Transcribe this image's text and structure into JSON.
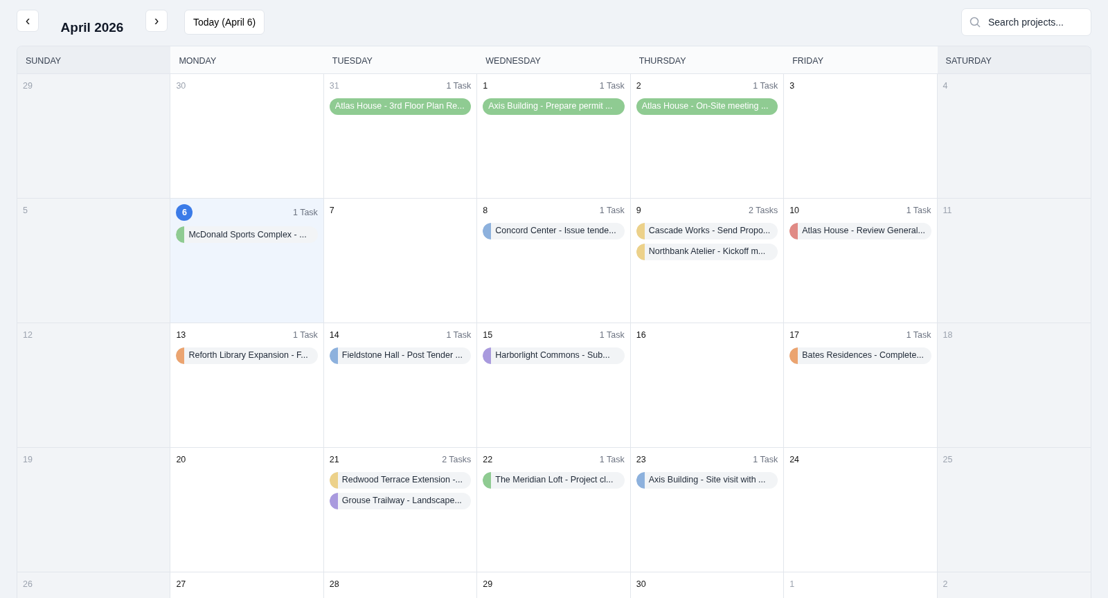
{
  "toolbar": {
    "prev": "‹",
    "month": "April 2026",
    "next": "›",
    "today_button": "Today (April 6)",
    "search": {
      "placeholder": "Search projects..."
    }
  },
  "weekdays": [
    {
      "label": "SUNDAY",
      "weekend": true
    },
    {
      "label": "MONDAY",
      "weekend": false
    },
    {
      "label": "TUESDAY",
      "weekend": false
    },
    {
      "label": "WEDNESDAY",
      "weekend": false
    },
    {
      "label": "THURSDAY",
      "weekend": false
    },
    {
      "label": "FRIDAY",
      "weekend": false
    },
    {
      "label": "SATURDAY",
      "weekend": true
    }
  ],
  "weeks": [
    {
      "days": [
        {
          "number": "29",
          "muted": true,
          "weekend": true,
          "today": false
        },
        {
          "number": "30",
          "muted": true,
          "weekend": false,
          "today": false
        },
        {
          "number": "31",
          "muted": true,
          "weekend": false,
          "today": false,
          "count": "1 Task",
          "tasks": [
            {
              "label": "Atlas House - 3rd Floor Plan Re...",
              "kind": "solid",
              "color": "#8fcb92"
            }
          ]
        },
        {
          "number": "1",
          "muted": false,
          "weekend": false,
          "today": false,
          "count": "1 Task",
          "tasks": [
            {
              "label": "Axis Building - Prepare permit ...",
              "kind": "solid",
              "color": "#8fcb92"
            }
          ]
        },
        {
          "number": "2",
          "muted": false,
          "weekend": false,
          "today": false,
          "count": "1 Task",
          "tasks": [
            {
              "label": "Atlas House - On-Site meeting ...",
              "kind": "solid",
              "color": "#8fcb92"
            }
          ]
        },
        {
          "number": "3",
          "muted": false,
          "weekend": false,
          "today": false
        },
        {
          "number": "4",
          "muted": true,
          "weekend": true,
          "today": false
        }
      ]
    },
    {
      "days": [
        {
          "number": "5",
          "muted": true,
          "weekend": true,
          "today": false
        },
        {
          "number": "6",
          "muted": false,
          "weekend": false,
          "today": true,
          "count": "1 Task",
          "tasks": [
            {
              "label": "McDonald Sports Complex - ...",
              "kind": "tagged",
              "color": "#8fcb92"
            }
          ]
        },
        {
          "number": "7",
          "muted": false,
          "weekend": false,
          "today": false
        },
        {
          "number": "8",
          "muted": false,
          "weekend": false,
          "today": false,
          "count": "1 Task",
          "tasks": [
            {
              "label": "Concord Center - Issue tende...",
              "kind": "tagged",
              "color": "#8db1dd"
            }
          ]
        },
        {
          "number": "9",
          "muted": false,
          "weekend": false,
          "today": false,
          "count": "2 Tasks",
          "tasks": [
            {
              "label": "Cascade Works - Send Propo...",
              "kind": "tagged",
              "color": "#ecd18a"
            },
            {
              "label": "Northbank Atelier - Kickoff m...",
              "kind": "tagged",
              "color": "#ecd18a"
            }
          ]
        },
        {
          "number": "10",
          "muted": false,
          "weekend": false,
          "today": false,
          "count": "1 Task",
          "tasks": [
            {
              "label": "Atlas House - Review General...",
              "kind": "tagged",
              "color": "#e08a85"
            }
          ]
        },
        {
          "number": "11",
          "muted": true,
          "weekend": true,
          "today": false
        }
      ]
    },
    {
      "days": [
        {
          "number": "12",
          "muted": true,
          "weekend": true,
          "today": false
        },
        {
          "number": "13",
          "muted": false,
          "weekend": false,
          "today": false,
          "count": "1 Task",
          "tasks": [
            {
              "label": "Reforth Library Expansion - F...",
              "kind": "tagged",
              "color": "#eba470"
            }
          ]
        },
        {
          "number": "14",
          "muted": false,
          "weekend": false,
          "today": false,
          "count": "1 Task",
          "tasks": [
            {
              "label": "Fieldstone Hall - Post Tender ...",
              "kind": "tagged",
              "color": "#8db1dd"
            }
          ]
        },
        {
          "number": "15",
          "muted": false,
          "weekend": false,
          "today": false,
          "count": "1 Task",
          "tasks": [
            {
              "label": "Harborlight Commons - Sub...",
              "kind": "tagged",
              "color": "#a99ade"
            }
          ]
        },
        {
          "number": "16",
          "muted": false,
          "weekend": false,
          "today": false
        },
        {
          "number": "17",
          "muted": false,
          "weekend": false,
          "today": false,
          "count": "1 Task",
          "tasks": [
            {
              "label": "Bates Residences - Complete...",
              "kind": "tagged",
              "color": "#eba470"
            }
          ]
        },
        {
          "number": "18",
          "muted": true,
          "weekend": true,
          "today": false
        }
      ]
    },
    {
      "days": [
        {
          "number": "19",
          "muted": true,
          "weekend": true,
          "today": false
        },
        {
          "number": "20",
          "muted": false,
          "weekend": false,
          "today": false
        },
        {
          "number": "21",
          "muted": false,
          "weekend": false,
          "today": false,
          "count": "2 Tasks",
          "tasks": [
            {
              "label": "Redwood Terrace Extension -...",
              "kind": "tagged",
              "color": "#ecd18a"
            },
            {
              "label": "Grouse Trailway - Landscape...",
              "kind": "tagged",
              "color": "#a99ade"
            }
          ]
        },
        {
          "number": "22",
          "muted": false,
          "weekend": false,
          "today": false,
          "count": "1 Task",
          "tasks": [
            {
              "label": "The Meridian Loft - Project cl...",
              "kind": "tagged",
              "color": "#8fcb92"
            }
          ]
        },
        {
          "number": "23",
          "muted": false,
          "weekend": false,
          "today": false,
          "count": "1 Task",
          "tasks": [
            {
              "label": "Axis Building - Site visit with ...",
              "kind": "tagged",
              "color": "#8db1dd"
            }
          ]
        },
        {
          "number": "24",
          "muted": false,
          "weekend": false,
          "today": false
        },
        {
          "number": "25",
          "muted": true,
          "weekend": true,
          "today": false
        }
      ]
    },
    {
      "days": [
        {
          "number": "26",
          "muted": true,
          "weekend": true,
          "today": false
        },
        {
          "number": "27",
          "muted": false,
          "weekend": false,
          "today": false
        },
        {
          "number": "28",
          "muted": false,
          "weekend": false,
          "today": false
        },
        {
          "number": "29",
          "muted": false,
          "weekend": false,
          "today": false
        },
        {
          "number": "30",
          "muted": false,
          "weekend": false,
          "today": false
        },
        {
          "number": "1",
          "muted": true,
          "weekend": false,
          "today": false
        },
        {
          "number": "2",
          "muted": true,
          "weekend": true,
          "today": false
        }
      ]
    }
  ]
}
